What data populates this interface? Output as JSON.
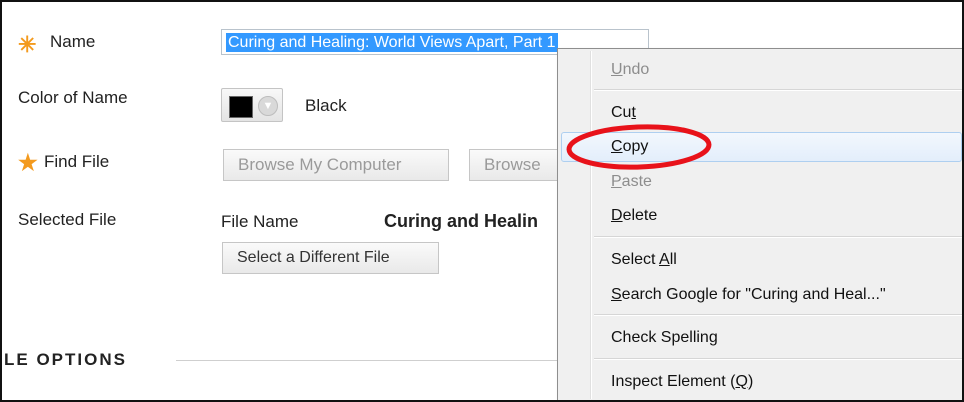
{
  "form": {
    "name_label": "Name",
    "name_value": "Curing and Healing: World Views Apart, Part 1",
    "color_label": "Color of Name",
    "color_value": "Black",
    "find_file_label": "Find File",
    "browse_computer": "Browse My Computer",
    "browse_other": "Browse",
    "selected_file_label": "Selected File",
    "file_name_label": "File Name",
    "file_name_value": "Curing and Healin",
    "select_different": "Select a Different File",
    "section_title": "LE OPTIONS"
  },
  "context_menu": {
    "undo": {
      "label": "Undo",
      "accel_index": 0
    },
    "cut": {
      "label": "Cut",
      "accel_index": 2
    },
    "copy": {
      "label": "Copy",
      "accel_index": 0
    },
    "paste": {
      "label": "Paste",
      "accel_index": 0
    },
    "delete": {
      "label": "Delete",
      "accel_index": 0
    },
    "select_all": {
      "label": "Select All",
      "accel_index": 7
    },
    "search_google": {
      "label": "Search Google for \"Curing and Heal...\"",
      "accel_index": 0
    },
    "check_spelling": {
      "label": "Check Spelling",
      "accel_index": 13
    },
    "inspect": {
      "label": "Inspect Element (Q)",
      "accel_index": 17
    }
  },
  "colors": {
    "required_star": "#f39a1e",
    "selection": "#3399ff",
    "annotation_circle": "#e8121a"
  },
  "icons": {
    "required": "asterisk-icon",
    "dropdown": "chevron-down-icon"
  }
}
